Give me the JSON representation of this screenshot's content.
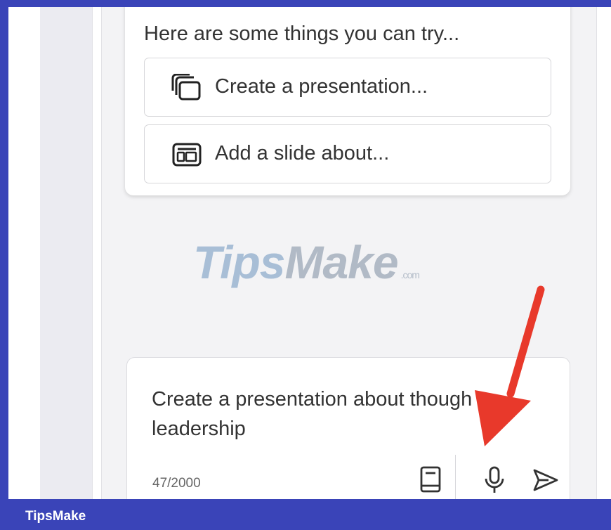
{
  "suggestions": {
    "heading": "Here are some things you can try...",
    "items": [
      {
        "label": "Create a presentation...",
        "icon": "copy-presentation-icon"
      },
      {
        "label": "Add a slide about...",
        "icon": "slide-layout-icon"
      }
    ]
  },
  "watermark": {
    "brand_t": "T",
    "brand_rest": "ips",
    "brand_m": "Make",
    "domain": ".com"
  },
  "compose": {
    "line1": "Create a presentation about though",
    "line2": "leadership",
    "counter": "47/2000",
    "icons": [
      "notebook-icon",
      "microphone-icon",
      "send-icon"
    ]
  },
  "footer": {
    "label": "TipsMake"
  },
  "colors": {
    "frame": "#3a44b8",
    "arrow": "#e8392b",
    "pane": "#f3f3f5"
  }
}
